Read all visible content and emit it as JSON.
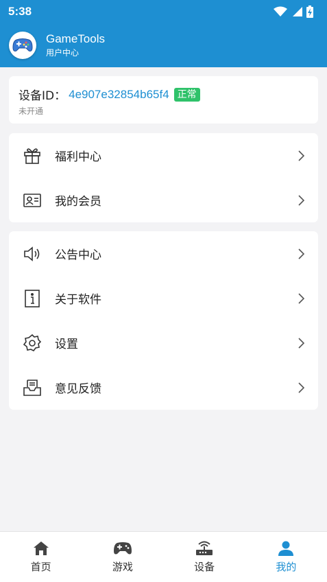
{
  "status_bar": {
    "time": "5:38"
  },
  "app_bar": {
    "title": "GameTools",
    "subtitle": "用户中心"
  },
  "device": {
    "label": "设备ID：",
    "id": "4e907e32854b65f4",
    "status_badge": "正常",
    "subscription": "未开通"
  },
  "menu_group_1": [
    {
      "label": "福利中心",
      "icon": "gift-icon"
    },
    {
      "label": "我的会员",
      "icon": "member-card-icon"
    }
  ],
  "menu_group_2": [
    {
      "label": "公告中心",
      "icon": "speaker-icon"
    },
    {
      "label": "关于软件",
      "icon": "info-icon"
    },
    {
      "label": "设置",
      "icon": "gear-icon"
    },
    {
      "label": "意见反馈",
      "icon": "inbox-icon"
    }
  ],
  "tabs": [
    {
      "label": "首页",
      "icon": "home-icon"
    },
    {
      "label": "游戏",
      "icon": "gamepad-icon"
    },
    {
      "label": "设备",
      "icon": "router-icon"
    },
    {
      "label": "我的",
      "icon": "person-icon",
      "active": true
    }
  ],
  "colors": {
    "primary": "#1e8fd2",
    "badge": "#2fc26a",
    "background": "#f3f3f5"
  }
}
